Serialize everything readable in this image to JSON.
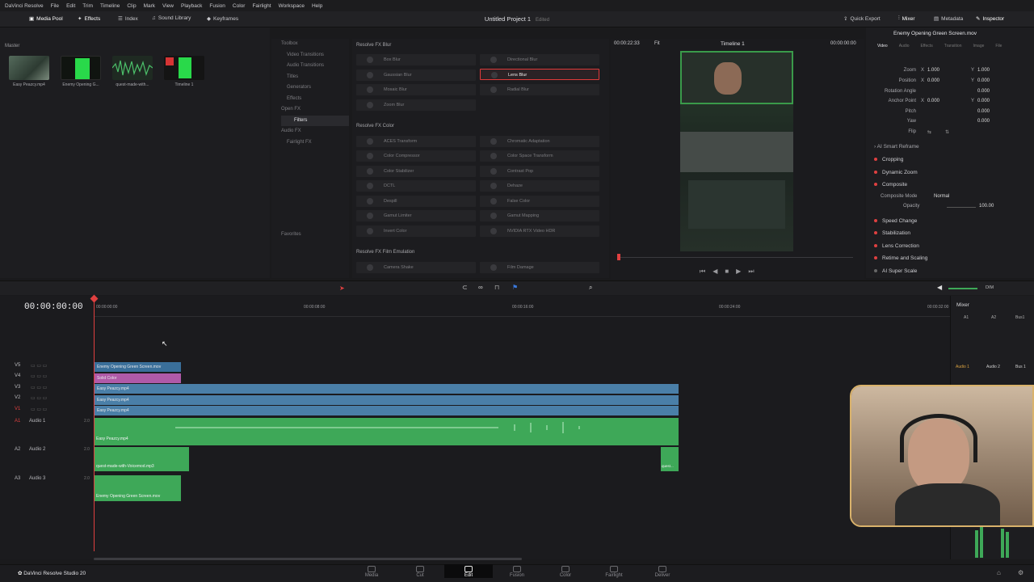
{
  "menu": [
    "DaVinci Resolve",
    "File",
    "Edit",
    "Trim",
    "Timeline",
    "Clip",
    "Mark",
    "View",
    "Playback",
    "Fusion",
    "Color",
    "Fairlight",
    "Workspace",
    "Help"
  ],
  "toolbar": {
    "media_pool": "Media Pool",
    "effects": "Effects",
    "index": "Index",
    "sound_library": "Sound Library",
    "keyframes": "Keyframes",
    "quick_export": "Quick Export",
    "mixer": "Mixer",
    "metadata": "Metadata",
    "inspector": "Inspector"
  },
  "project": {
    "title": "Untitled Project 1",
    "status": "Edited"
  },
  "media_pool": {
    "bin": "Master",
    "items": [
      {
        "name": "Easy Peazcy.mp4"
      },
      {
        "name": "Enemy Opening G..."
      },
      {
        "name": "quest-made-with..."
      },
      {
        "name": "Timeline 1"
      }
    ]
  },
  "fx_tree": {
    "toolbox": "Toolbox",
    "items": [
      "Video Transitions",
      "Audio Transitions",
      "Titles",
      "Generators",
      "Effects"
    ],
    "open_fx": "Open FX",
    "filters": "Filters",
    "audio_fx": "Audio FX",
    "fairlight_fx": "Fairlight FX",
    "favorites": "Favorites"
  },
  "effects": {
    "blur_header": "Resolve FX Blur",
    "blur": [
      "Box Blur",
      "Directional Blur",
      "Gaussian Blur",
      "Lens Blur",
      "Mosaic Blur",
      "Radial Blur",
      "Zoom Blur"
    ],
    "color_header": "Resolve FX Color",
    "color": [
      "ACES Transform",
      "Chromatic Adaptation",
      "Color Compressor",
      "Color Space Transform",
      "Color Stabilizer",
      "Contrast Pop",
      "DCTL",
      "Dehaze",
      "Despill",
      "False Color",
      "Gamut Limiter",
      "Gamut Mapping",
      "Invert Color",
      "NVIDIA RTX Video HDR"
    ],
    "film_header": "Resolve FX Film Emulation",
    "film": [
      "Camera Shake",
      "Film Damage"
    ]
  },
  "viewer": {
    "timecode_left": "00:00:22:33",
    "zoom": "Fit",
    "timeline": "Timeline 1",
    "timecode_right": "00:00:00:00"
  },
  "inspector": {
    "clip": "Enemy Opening Green Screen.mov",
    "tabs": [
      "Video",
      "Audio",
      "Effects",
      "Transition",
      "Image",
      "File"
    ],
    "rows": [
      {
        "label": "Zoom",
        "x_label": "X",
        "x": "1.000",
        "y_label": "Y",
        "y": "1.000"
      },
      {
        "label": "Position",
        "x_label": "X",
        "x": "0.000",
        "y_label": "Y",
        "y": "0.000"
      },
      {
        "label": "Rotation Angle",
        "x_label": "",
        "x": "",
        "y_label": "",
        "y": "0.000"
      },
      {
        "label": "Anchor Point",
        "x_label": "X",
        "x": "0.000",
        "y_label": "Y",
        "y": "0.000"
      },
      {
        "label": "Pitch",
        "x_label": "",
        "x": "",
        "y_label": "",
        "y": "0.000"
      },
      {
        "label": "Yaw",
        "x_label": "",
        "x": "",
        "y_label": "",
        "y": "0.000"
      },
      {
        "label": "Flip",
        "x_label": "",
        "x": "",
        "y_label": "",
        "y": ""
      }
    ],
    "smart_reframe": "AI Smart Reframe",
    "cropping": "Cropping",
    "dynamic_zoom": "Dynamic Zoom",
    "composite": "Composite",
    "composite_mode_label": "Composite Mode",
    "composite_mode": "Normal",
    "opacity_label": "Opacity",
    "opacity": "100.00",
    "sections": [
      "Speed Change",
      "Stabilization",
      "Lens Correction",
      "Retime and Scaling",
      "AI Super Scale"
    ]
  },
  "timeline": {
    "timecode": "00:00:00:00",
    "ruler": [
      "00:00:00:00",
      "00:00:08:00",
      "00:00:16:00",
      "00:00:24:00",
      "00:00:32:00"
    ],
    "tracks": [
      {
        "id": "V5",
        "name": ""
      },
      {
        "id": "V4",
        "name": ""
      },
      {
        "id": "V3",
        "name": ""
      },
      {
        "id": "V2",
        "name": ""
      },
      {
        "id": "V1",
        "name": ""
      },
      {
        "id": "A1",
        "name": "Audio 1",
        "ch": "2.0"
      },
      {
        "id": "A2",
        "name": "Audio 2",
        "ch": "2.0"
      },
      {
        "id": "A3",
        "name": "Audio 3",
        "ch": "2.0"
      }
    ],
    "clips": {
      "v5": "Enemy Opening Green Screen.mov",
      "v4": "Solid Color",
      "v3": "Easy Peazcy.mp4",
      "v2": "Easy Peazcy.mp4",
      "v1": "Easy Peazcy.mp4",
      "a1": "Easy Peazcy.mp4",
      "a2": "quest-made-with-Voicemod.mp3",
      "a2b": "quest...",
      "a3": "Enemy Opening Green Screen.mov"
    }
  },
  "mixer": {
    "title": "Mixer",
    "channels": [
      "A1",
      "A2",
      "Bus1"
    ],
    "strips": [
      "Audio 1",
      "Audio 2",
      "Bus 1"
    ],
    "dim": "DIM"
  },
  "app": {
    "name": "DaVinci Resolve Studio 20"
  },
  "pages": [
    "Media",
    "Cut",
    "Edit",
    "Fusion",
    "Color",
    "Fairlight",
    "Deliver"
  ],
  "active_page": "Edit",
  "colors": {
    "accent": "#e04040",
    "video_clip": "#4a7fa8",
    "audio_clip": "#3ea858",
    "solid_color": "#b05aa8"
  }
}
